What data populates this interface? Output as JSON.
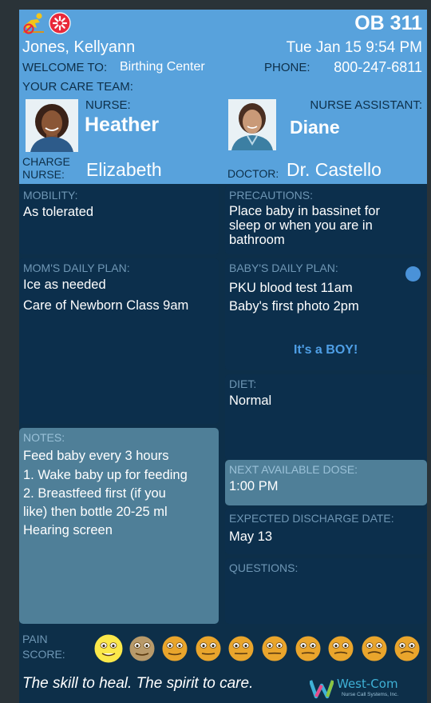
{
  "header": {
    "patient_name": "Jones, Kellyann",
    "welcome_label": "WELCOME TO:",
    "location": "Birthing Center",
    "care_team_label": "YOUR CARE TEAM:",
    "room": "OB 311",
    "datetime": "Tue Jan 15  9:54 PM",
    "phone_label": "PHONE:",
    "phone": "800-247-6811",
    "alert_icons": [
      "fall-risk-icon",
      "latex-allergy-icon"
    ]
  },
  "care_team": {
    "nurse_role": "NURSE:",
    "nurse_name": "Heather",
    "assistant_role": "NURSE ASSISTANT:",
    "assistant_name": "Diane",
    "charge_role_line1": "CHARGE",
    "charge_role_line2": "NURSE:",
    "charge_name": "Elizabeth",
    "doctor_role": "DOCTOR:",
    "doctor_name": "Dr. Castello"
  },
  "panels": {
    "mobility": {
      "title": "MOBILITY:",
      "lines": [
        "As tolerated"
      ]
    },
    "precautions": {
      "title": "PRECAUTIONS:",
      "lines": [
        "Place baby in bassinet for",
        "sleep or when you are in",
        "bathroom"
      ]
    },
    "mom_plan": {
      "title": "MOM'S DAILY PLAN:",
      "lines": [
        "Ice as needed",
        "Care of Newborn Class 9am"
      ]
    },
    "baby_plan": {
      "title": "BABY'S DAILY PLAN:",
      "lines": [
        "PKU blood test 11am",
        "Baby's first photo 2pm"
      ],
      "announcement": "It's a BOY!"
    },
    "diet": {
      "title": "DIET:",
      "lines": [
        "Normal"
      ]
    },
    "notes": {
      "title": "NOTES:",
      "lines": [
        "Feed baby every 3 hours",
        "1. Wake baby up for feeding",
        "2. Breastfeed first (if you",
        "like) then bottle 20-25 ml",
        "Hearing screen"
      ]
    },
    "next_dose": {
      "title": "NEXT AVAILABLE DOSE:",
      "lines": [
        "1:00 PM"
      ]
    },
    "discharge": {
      "title": "EXPECTED DISCHARGE DATE:",
      "lines": [
        "May 13"
      ]
    },
    "questions": {
      "title": "QUESTIONS:",
      "lines": []
    }
  },
  "pain": {
    "label_line1": "PAIN",
    "label_line2": "SCORE:",
    "selected_index": 0,
    "face_count": 10
  },
  "footer": {
    "tagline": "The skill to heal. The spirit to care.",
    "brand": "West-Com",
    "brand_sub": "Nurse Call Systems, Inc."
  },
  "colors": {
    "header_bg": "#58a2dc",
    "panel_bg": "#0c2f4c",
    "panel_light_bg": "#4f7f98",
    "title_text": "#6f97b5",
    "announcement": "#4f9fe6",
    "alert_red": "#e8283a",
    "fall_yellow": "#f3c51a",
    "selected_face": "#fbe84a",
    "face_orange": "#e9a52c"
  }
}
